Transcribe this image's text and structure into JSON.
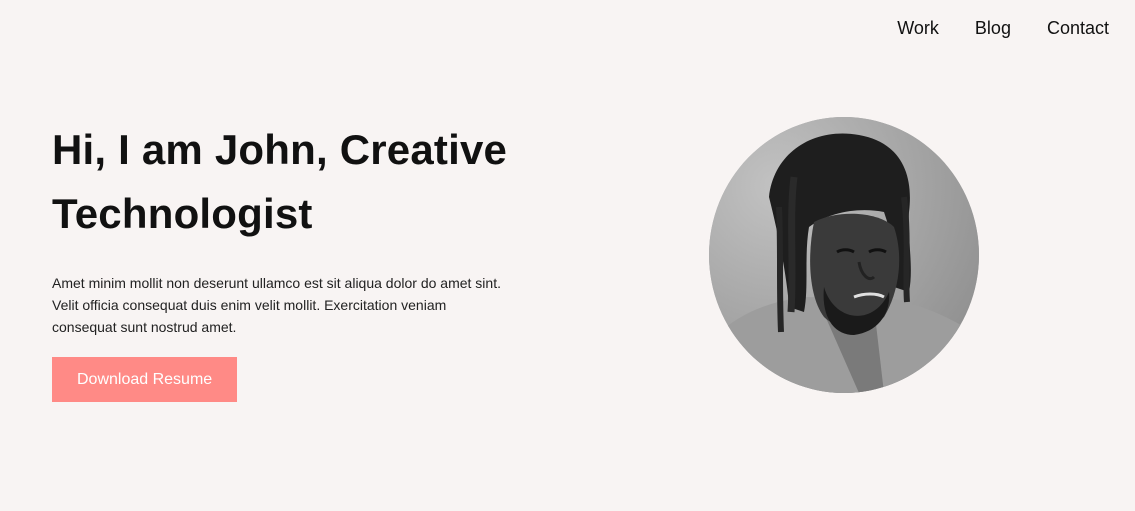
{
  "nav": {
    "items": [
      {
        "label": "Work"
      },
      {
        "label": "Blog"
      },
      {
        "label": "Contact"
      }
    ]
  },
  "hero": {
    "title_line1": "Hi, I am John, Creative",
    "title_line2": "Technologist",
    "description": "Amet minim mollit non deserunt ullamco est sit aliqua dolor do amet sint. Velit officia consequat duis enim velit mollit. Exercitation veniam consequat sunt nostrud amet.",
    "cta_label": "Download Resume"
  },
  "colors": {
    "background": "#f8f4f3",
    "accent": "#ff8a86",
    "text": "#111111"
  },
  "avatar": {
    "icon": "profile-photo-grayscale"
  }
}
